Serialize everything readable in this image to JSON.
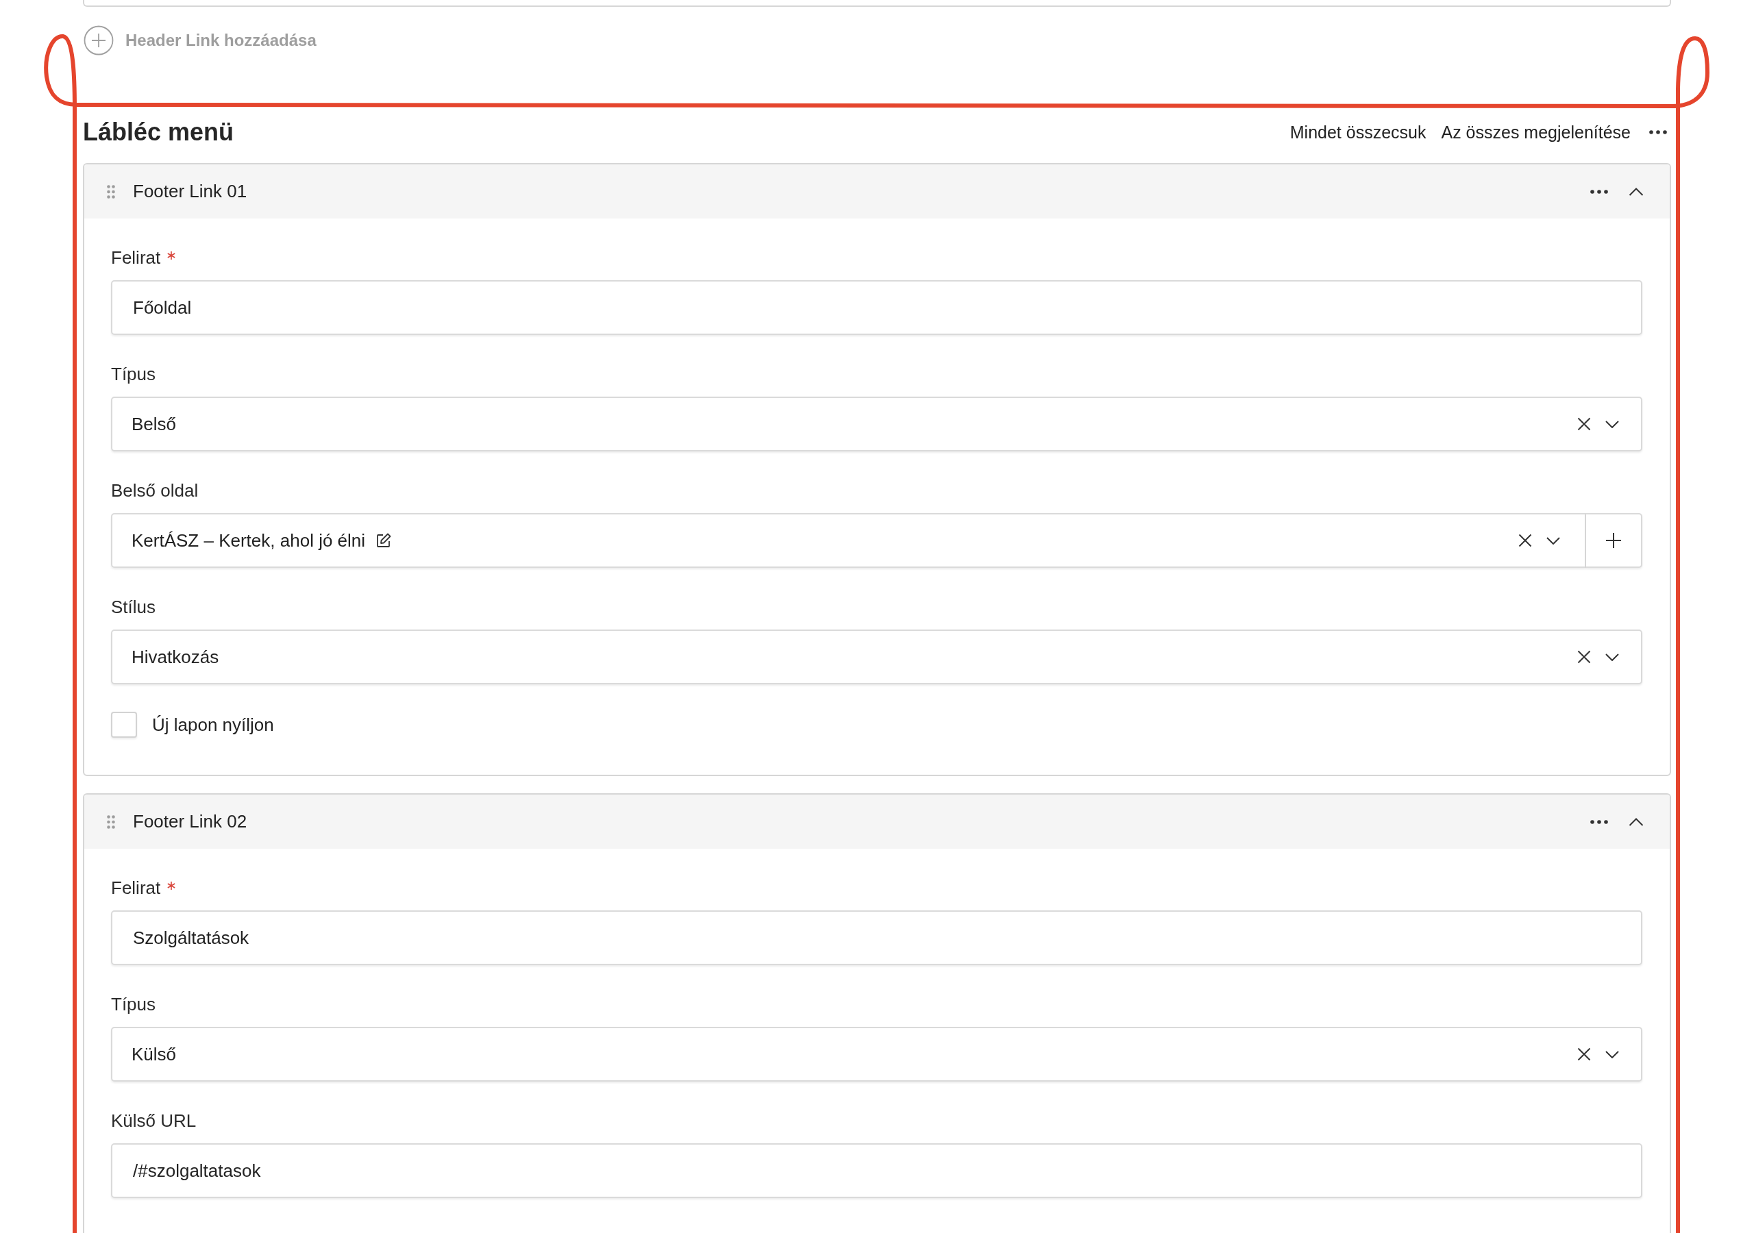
{
  "header_links_add": {
    "label": "Header Link hozzáadása"
  },
  "footer_menu": {
    "title": "Lábléc menü",
    "actions": [
      "Mindet összecsuk",
      "Az összes megjelenítése"
    ],
    "items": [
      {
        "title": "Footer Link 01",
        "expanded": true,
        "fields": [
          {
            "kind": "text",
            "label": "Felirat",
            "required": true,
            "value": "Főoldal"
          },
          {
            "kind": "select",
            "label": "Típus",
            "required": false,
            "value": "Belső"
          },
          {
            "kind": "page_select",
            "label": "Belső oldal",
            "required": false,
            "value": "KertÁSZ – Kertek, ahol jó élni"
          },
          {
            "kind": "select",
            "label": "Stílus",
            "required": false,
            "value": "Hivatkozás"
          },
          {
            "kind": "checkbox",
            "label": "Új lapon nyíljon",
            "required": false,
            "checked": false
          }
        ]
      },
      {
        "title": "Footer Link 02",
        "expanded": true,
        "fields": [
          {
            "kind": "text",
            "label": "Felirat",
            "required": true,
            "value": "Szolgáltatások"
          },
          {
            "kind": "select",
            "label": "Típus",
            "required": false,
            "value": "Külső"
          },
          {
            "kind": "text",
            "label": "Külső URL",
            "required": false,
            "value": "/#szolgaltatasok"
          }
        ]
      }
    ]
  }
}
